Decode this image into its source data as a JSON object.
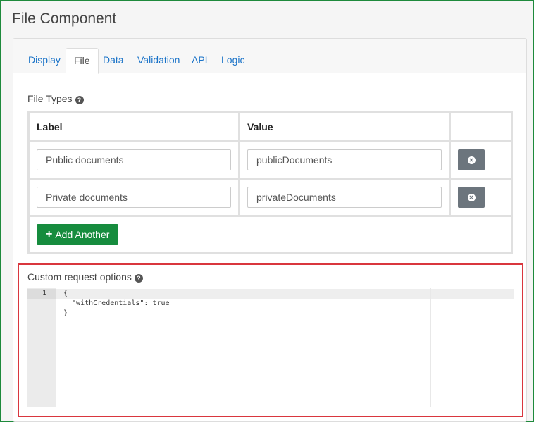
{
  "window": {
    "title": "File Component"
  },
  "tabs": [
    {
      "label": "Display",
      "active": false
    },
    {
      "label": "File",
      "active": true
    },
    {
      "label": "Data",
      "active": false
    },
    {
      "label": "Validation",
      "active": false
    },
    {
      "label": "API",
      "active": false
    },
    {
      "label": "Logic",
      "active": false
    }
  ],
  "file_types": {
    "label": "File Types",
    "help_icon": "question-circle-icon",
    "columns": [
      "Label",
      "Value"
    ],
    "rows": [
      {
        "label": "Public documents",
        "value": "publicDocuments",
        "remove_icon": "times-circle-icon"
      },
      {
        "label": "Private documents",
        "value": "privateDocuments",
        "remove_icon": "times-circle-icon"
      }
    ],
    "add_label": "Add Another",
    "add_icon": "plus-icon"
  },
  "custom_request": {
    "label": "Custom request options",
    "help_icon": "question-circle-icon",
    "line_number": "1",
    "code": "{\n  \"withCredentials\": true\n}"
  },
  "colors": {
    "frame_border": "#1e8a3c",
    "highlight_border": "#d9363e",
    "tab_link": "#1a73c8",
    "add_button": "#168c3e",
    "remove_button": "#6c757d"
  }
}
